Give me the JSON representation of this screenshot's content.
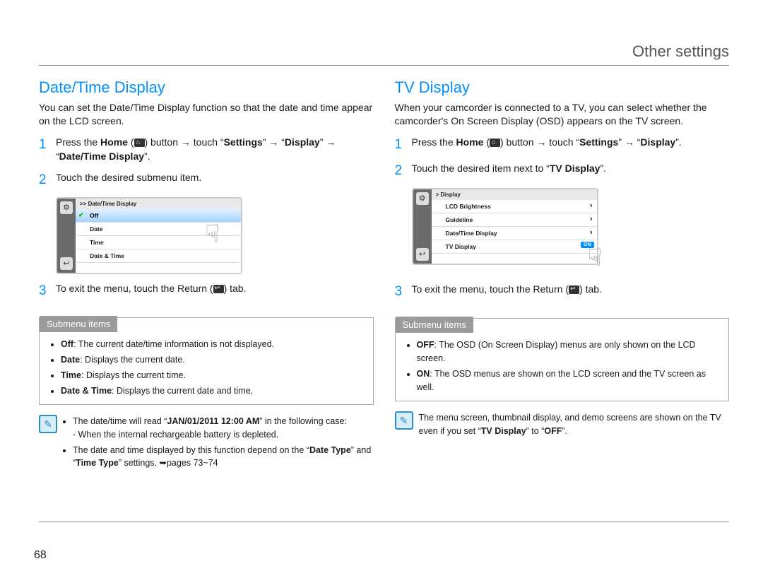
{
  "header": "Other settings",
  "pageNumber": "68",
  "left": {
    "title": "Date/Time Display",
    "intro": "You can set the Date/Time Display function so that the date and time appear on the LCD screen.",
    "step1_pre": "Press the ",
    "step1_home": "Home",
    "step1_mid": " button → touch “",
    "step1_settings": "Settings",
    "step1_arrow": "” → “",
    "step1_display": "Display",
    "step1_arrow2": "” → “",
    "step1_dtd": "Date/Time Display",
    "step1_end": "”.",
    "step2": "Touch the desired submenu item.",
    "step3_pre": "To exit the menu, touch the Return (",
    "step3_end": ") tab.",
    "lcd": {
      "crumb": ">> Date/Time Display",
      "r1": "Off",
      "r2": "Date",
      "r3": "Time",
      "r4": "Date & Time"
    },
    "submenu_title": "Submenu items",
    "submenu": {
      "off_b": "Off",
      "off": ": The current date/time information is not displayed.",
      "date_b": "Date",
      "date": ": Displays the current date.",
      "time_b": "Time",
      "time": ": Displays the current time.",
      "dt_b": "Date & Time",
      "dt": ": Displays the current date and time."
    },
    "note1_pre": "The date/time will read “",
    "note1_bold": "JAN/01/2011 12:00 AM",
    "note1_post": "” in the following case:",
    "note1_sub": "- When the internal rechargeable battery is depleted.",
    "note2_pre": "The date and time displayed by this function depend on the “",
    "note2_b1": "Date Type",
    "note2_mid": "” and “",
    "note2_b2": "Time Type",
    "note2_post": "” settings. ➥pages 73~74"
  },
  "right": {
    "title": "TV Display",
    "intro": "When your camcorder is connected to a TV, you can select whether the camcorder's On Screen Display (OSD) appears on the TV screen.",
    "step1_pre": "Press the ",
    "step1_home": "Home",
    "step1_mid": " button → touch “",
    "step1_settings": "Settings",
    "step1_arrow": "” → “",
    "step1_display": "Display",
    "step1_end": "”.",
    "step2_pre": "Touch the desired item next to “",
    "step2_b": "TV Display",
    "step2_end": "”.",
    "step3_pre": "To exit the menu, touch the Return (",
    "step3_end": ") tab.",
    "lcd": {
      "crumb": "> Display",
      "r1": "LCD Brightness",
      "r2": "Guideline",
      "r3": "Date/Time Display",
      "r4": "TV Display",
      "on": "ON"
    },
    "submenu_title": "Submenu items",
    "submenu": {
      "off_b": "OFF",
      "off": ": The OSD (On Screen Display) menus are only shown on the LCD screen.",
      "on_b": "ON",
      "on": ": The OSD menus are shown on the LCD screen and the TV screen as well."
    },
    "note_pre": "The menu screen, thumbnail display, and demo screens are shown on the TV even if you set “",
    "note_b": "TV Display",
    "note_mid": "” to “",
    "note_b2": "OFF",
    "note_end": "”."
  }
}
